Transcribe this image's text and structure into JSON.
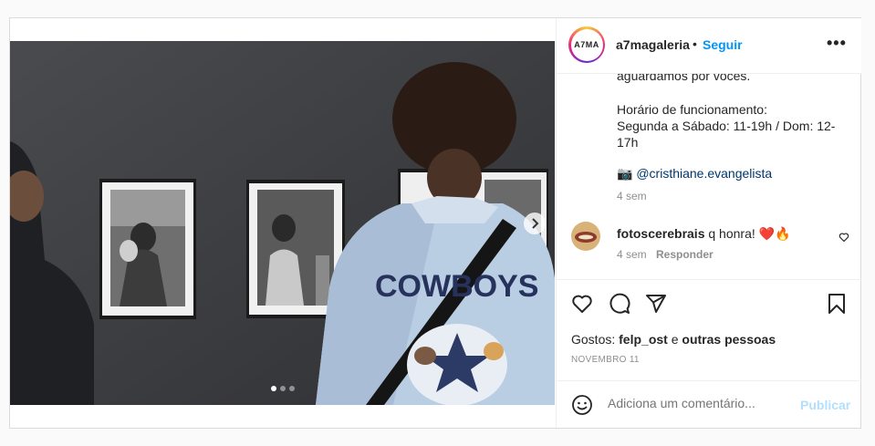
{
  "post": {
    "username": "a7magaleria",
    "avatar_text": "A7MA",
    "follow_label": "Seguir",
    "more_label": "•••",
    "bullet": "•"
  },
  "caption": {
    "lines": [
      "aguardamos por vocês.",
      "Horário de funcionamento:",
      "Segunda a Sábado: 11-19h / Dom: 12-",
      "17h"
    ],
    "camera_emoji": "📷",
    "mention": "@cristhiane.evangelista",
    "time": "4 sem"
  },
  "comment": {
    "username": "fotoscerebrais",
    "text": "q honra! ❤️🔥",
    "time": "4 sem",
    "reply_label": "Responder"
  },
  "likes": {
    "prefix": "Gostos: ",
    "user": "felp_ost",
    "joiner": " e ",
    "others": "outras pessoas"
  },
  "date": "NOVEMBRO 11",
  "add_comment": {
    "placeholder": "Adiciona um comentário...",
    "publish_label": "Publicar"
  },
  "carousel": {
    "current": 1,
    "total": 3
  },
  "colors": {
    "link": "#0095f6",
    "mention": "#00376b",
    "muted": "#8e8e8e"
  },
  "icons": [
    "chevron-right-icon",
    "more-icon",
    "heart-icon",
    "comment-icon",
    "share-icon",
    "bookmark-icon",
    "emoji-icon"
  ]
}
